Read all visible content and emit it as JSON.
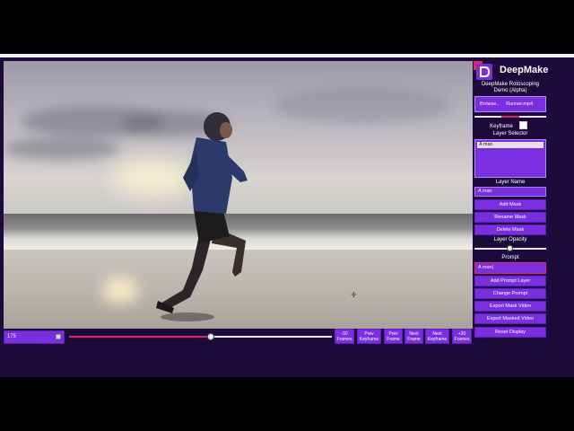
{
  "app": {
    "brand": "DeepMake",
    "subtitle": "DeepMake Rotoscoping Demo (Alpha)",
    "accent": "#7b2de0",
    "highlight": "#e0256b",
    "background": "#1c0b3a"
  },
  "file": {
    "browse_label": "Browse...",
    "filename": "Runner.mp4"
  },
  "keyframe": {
    "label": "Keyframe",
    "checked": false
  },
  "layer_selector": {
    "label": "Layer Selector",
    "items": [
      "A man"
    ]
  },
  "layer_name": {
    "label": "Layer Name",
    "value": "A man"
  },
  "mask_buttons": {
    "add": "Add Mask",
    "rename": "Rename Mask",
    "delete": "Delete Mask"
  },
  "layer_opacity": {
    "label": "Layer Opacity",
    "value": 0.5
  },
  "prompt": {
    "label": "Prompt",
    "value": "A man|"
  },
  "actions": {
    "add_prompt_layer": "Add Prompt Layer",
    "change_prompt": "Change Prompt",
    "export_mask_video": "Export Mask Video",
    "export_masked_video": "Export Masked Video",
    "reset_display": "Reset Display"
  },
  "timeline": {
    "frame": "175",
    "progress": 0.54
  },
  "nav": {
    "minus30": "-30 Frames",
    "prev_keyframe": "Prev Keyframe",
    "prev_frame": "Prev Frame",
    "next_frame": "Next Frame",
    "next_keyframe": "Next Keyframe",
    "plus30": "+30 Frames"
  }
}
